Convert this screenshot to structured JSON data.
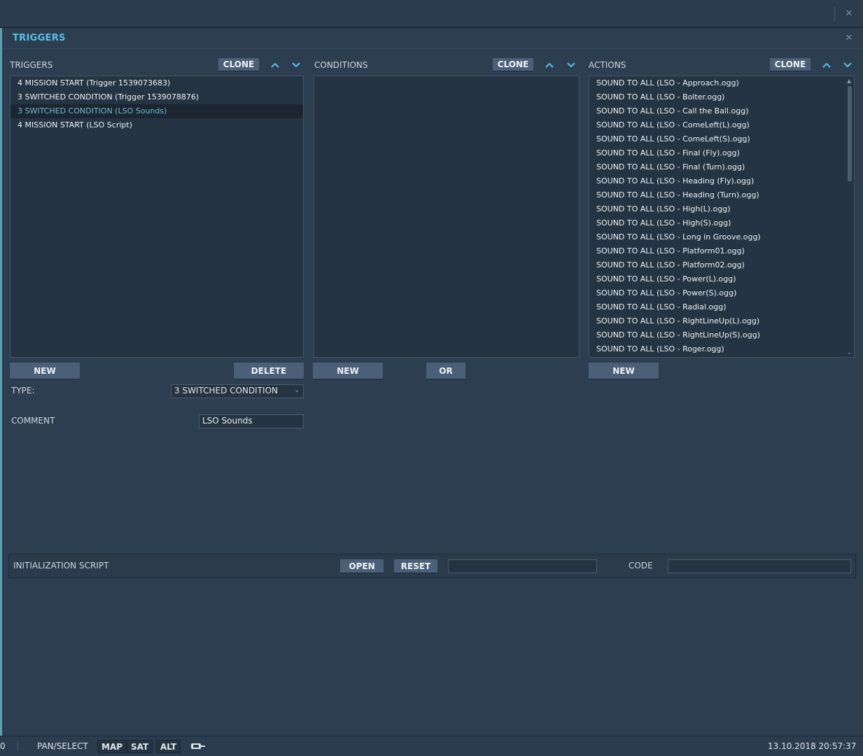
{
  "topbar": {
    "close_icon": "close-icon"
  },
  "window": {
    "title": "TRIGGERS",
    "close_icon": "close-icon"
  },
  "triggers_panel": {
    "label": "TRIGGERS",
    "clone_label": "CLONE",
    "items": [
      "4 MISSION START (Trigger 1539073683)",
      "3 SWITCHED CONDITION (Trigger 1539078876)",
      "3 SWITCHED CONDITION (LSO Sounds)",
      "4 MISSION START (LSO Script)"
    ],
    "selected_index": 2,
    "new_label": "NEW",
    "delete_label": "DELETE",
    "type_label": "TYPE:",
    "type_value": "3 SWITCHED CONDITION",
    "comment_label": "COMMENT",
    "comment_value": "LSO Sounds"
  },
  "conditions_panel": {
    "label": "CONDITIONS",
    "clone_label": "CLONE",
    "new_label": "NEW",
    "or_label": "OR"
  },
  "actions_panel": {
    "label": "ACTIONS",
    "clone_label": "CLONE",
    "items": [
      "SOUND TO ALL (LSO - Approach.ogg)",
      "SOUND TO ALL (LSO - Bolter.ogg)",
      "SOUND TO ALL (LSO - Call the Ball.ogg)",
      "SOUND TO ALL (LSO - ComeLeft(L).ogg)",
      "SOUND TO ALL (LSO - ComeLeft(S).ogg)",
      "SOUND TO ALL (LSO - Final (Fly).ogg)",
      "SOUND TO ALL (LSO - Final (Turn).ogg)",
      "SOUND TO ALL (LSO - Heading (Fly).ogg)",
      "SOUND TO ALL (LSO - Heading (Turn).ogg)",
      "SOUND TO ALL (LSO - High(L).ogg)",
      "SOUND TO ALL (LSO - High(S).ogg)",
      "SOUND TO ALL (LSO - Long in Groove.ogg)",
      "SOUND TO ALL (LSO - Platform01.ogg)",
      "SOUND TO ALL (LSO - Platform02.ogg)",
      "SOUND TO ALL (LSO - Power(L).ogg)",
      "SOUND TO ALL (LSO - Power(S).ogg)",
      "SOUND TO ALL (LSO - Radial.ogg)",
      "SOUND TO ALL (LSO - RightLineUp(L).ogg)",
      "SOUND TO ALL (LSO - RightLineUp(S).ogg)",
      "SOUND TO ALL (LSO - Roger.ogg)"
    ],
    "new_label": "NEW"
  },
  "init_script": {
    "label": "INITIALIZATION SCRIPT",
    "open_label": "OPEN",
    "reset_label": "RESET",
    "file_value": "",
    "code_label": "CODE",
    "code_value": ""
  },
  "statusbar": {
    "left_value": "0",
    "mode": "PAN/SELECT",
    "map_label": "MAP",
    "sat_label": "SAT",
    "alt_label": "ALT",
    "datetime": "13.10.2018 20:57:37"
  },
  "colors": {
    "accent": "#55c2e8",
    "background": "#2d3e50",
    "button": "#4b6078",
    "list_bg": "#253443",
    "selected_text": "#6fbcd7"
  }
}
